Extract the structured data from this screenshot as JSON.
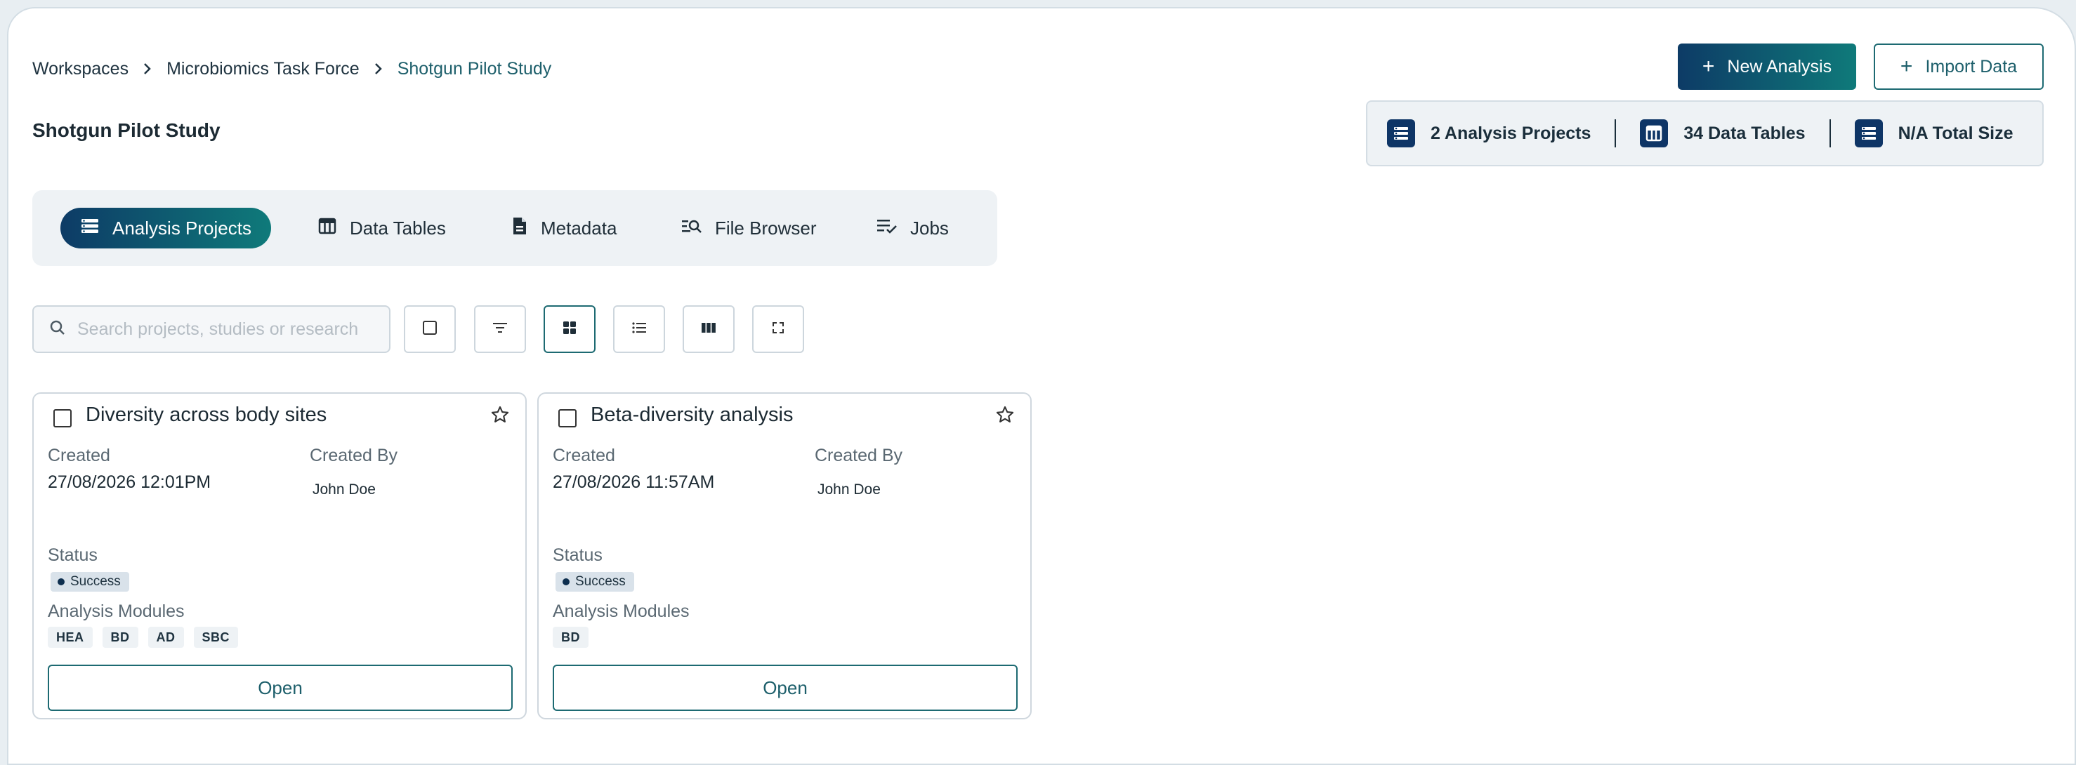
{
  "breadcrumb": [
    "Workspaces",
    "Microbiomics Task Force",
    "Shotgun Pilot Study"
  ],
  "page_title": "Shotgun Pilot Study",
  "header_buttons": {
    "new_analysis": "New Analysis",
    "import_data": "Import Data"
  },
  "stats": {
    "projects": "2 Analysis Projects",
    "tables": "34 Data Tables",
    "size": "N/A Total Size"
  },
  "tabs": [
    {
      "label": "Analysis Projects",
      "icon": "list-icon",
      "active": true
    },
    {
      "label": "Data Tables",
      "icon": "table-icon",
      "active": false
    },
    {
      "label": "Metadata",
      "icon": "document-icon",
      "active": false
    },
    {
      "label": "File Browser",
      "icon": "search-list-icon",
      "active": false
    },
    {
      "label": "Jobs",
      "icon": "checklist-icon",
      "active": false
    }
  ],
  "search": {
    "placeholder": "Search projects, studies or research",
    "value": ""
  },
  "toolbar": [
    "select-all-checkbox",
    "filter",
    "grid-view",
    "list-view",
    "column-view",
    "fullscreen"
  ],
  "cards": [
    {
      "title": "Diversity across body sites",
      "created_label": "Created",
      "created": "27/08/2026 12:01PM",
      "created_by_label": "Created By",
      "created_by": "John Doe",
      "status_label": "Status",
      "status": "Success",
      "modules_label": "Analysis Modules",
      "modules": [
        "HEA",
        "BD",
        "AD",
        "SBC"
      ],
      "open_label": "Open"
    },
    {
      "title": "Beta-diversity analysis",
      "created_label": "Created",
      "created": "27/08/2026 11:57AM",
      "created_by_label": "Created By",
      "created_by": "John Doe",
      "status_label": "Status",
      "status": "Success",
      "modules_label": "Analysis Modules",
      "modules": [
        "BD"
      ],
      "open_label": "Open"
    }
  ],
  "colors": {
    "brand_dark": "#0d3b66",
    "brand_teal": "#0f7a7a",
    "accent_text": "#1d5f6b"
  }
}
